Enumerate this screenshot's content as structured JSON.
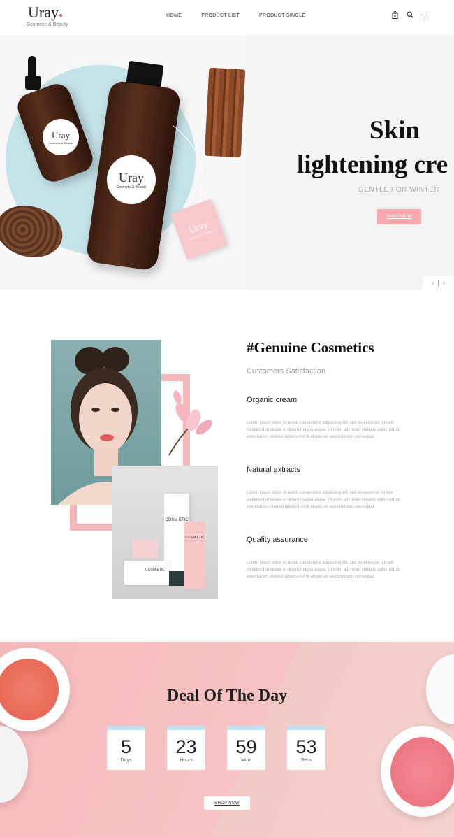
{
  "brand": {
    "name": "Uray",
    "tagline": "Cosmetic & Beauty"
  },
  "nav": {
    "items": [
      "HOME",
      "PRODUCT LIST",
      "PRODUCT SINGLE"
    ]
  },
  "header_icons": [
    "bag-icon",
    "search-icon",
    "menu-icon"
  ],
  "hero": {
    "title_line1": "Skin",
    "title_line2": "lightening cre",
    "subtitle": "GENTLE FOR WINTER",
    "button": "SHOP NOW",
    "bottle_small_label": "Uray",
    "bottle_small_sub": "Cosmetic & Beauty",
    "bottle_large_label": "Uray",
    "bottle_large_sub": "Cosmetic & Beauty",
    "tag_label": "Uray",
    "tag_sub": "Cosmetic & Beauty",
    "slider_prev": "‹",
    "slider_sep": "|",
    "slider_next": "›"
  },
  "genuine": {
    "title": "#Genuine Cosmetics",
    "subtitle": "Customers Satisfaction",
    "product_labels": [
      "COSM ETIC",
      "COSM ETIC",
      "COSM ETIC"
    ],
    "features": [
      {
        "title": "Organic cream",
        "text": "Lorem ipsum dolor sit amet, consectetur adipiscing elit, sed do eiusmod tempor incididunt ut labore et dolore magna aliqua. Ut enim ad minim veniam, quis nostrud exercitation ullamco laboris nisi ut aliquip ex ea commodo consequat."
      },
      {
        "title": "Natural extracts",
        "text": "Lorem ipsum dolor sit amet, consectetur adipiscing elit, sed do eiusmod tempor incididunt ut labore et dolore magna aliqua. Ut enim ad minim veniam, quis nostrud exercitation ullamco laboris nisi ut aliquip ex ea commodo consequat."
      },
      {
        "title": "Quality assurance",
        "text": "Lorem ipsum dolor sit amet, consectetur adipiscing elit, sed do eiusmod tempor incididunt ut labore et dolore magna aliqua. Ut enim ad minim veniam, quis nostrud exercitation ullamco laboris nisi ut aliquip ex ea commodo consequat."
      }
    ]
  },
  "deal": {
    "title": "Deal Of The Day",
    "counters": [
      {
        "value": "5",
        "unit": "Days"
      },
      {
        "value": "23",
        "unit": "Hours"
      },
      {
        "value": "59",
        "unit": "Mins"
      },
      {
        "value": "53",
        "unit": "Secs"
      }
    ],
    "button": "SHOP NOW"
  },
  "colors": {
    "accent_pink": "#f7a9ad",
    "circle_blue": "#c5e4ea",
    "counter_top": "#bfe3f0",
    "logo_dot": "#e8577a"
  }
}
